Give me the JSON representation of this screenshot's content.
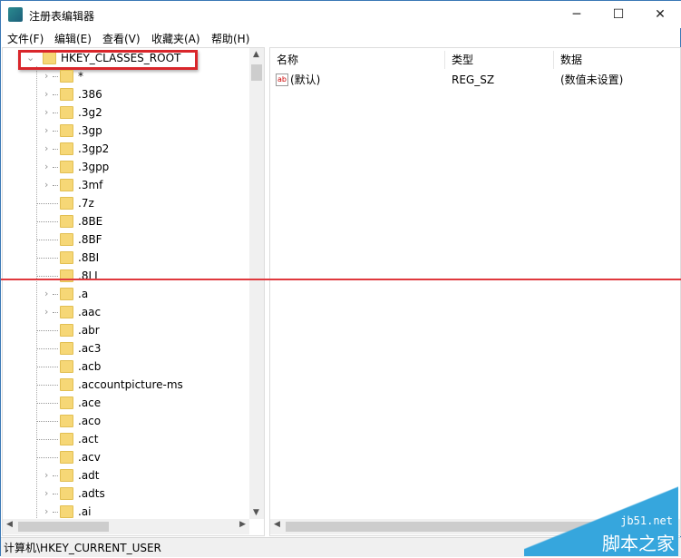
{
  "window": {
    "title": "注册表编辑器",
    "minimize": "─",
    "maximize": "☐",
    "close": "✕"
  },
  "menu": [
    "文件(F)",
    "编辑(E)",
    "查看(V)",
    "收藏夹(A)",
    "帮助(H)"
  ],
  "tree": {
    "root": "HKEY_CLASSES_ROOT",
    "items": [
      {
        "label": "*",
        "expandable": true
      },
      {
        "label": ".386",
        "expandable": true
      },
      {
        "label": ".3g2",
        "expandable": true
      },
      {
        "label": ".3gp",
        "expandable": true
      },
      {
        "label": ".3gp2",
        "expandable": true
      },
      {
        "label": ".3gpp",
        "expandable": true
      },
      {
        "label": ".3mf",
        "expandable": true
      },
      {
        "label": ".7z",
        "expandable": false
      },
      {
        "label": ".8BE",
        "expandable": false
      },
      {
        "label": ".8BF",
        "expandable": false
      },
      {
        "label": ".8BI",
        "expandable": false
      },
      {
        "label": ".8LI",
        "expandable": false
      },
      {
        "label": ".a",
        "expandable": true
      },
      {
        "label": ".aac",
        "expandable": true
      },
      {
        "label": ".abr",
        "expandable": false
      },
      {
        "label": ".ac3",
        "expandable": false
      },
      {
        "label": ".acb",
        "expandable": false
      },
      {
        "label": ".accountpicture-ms",
        "expandable": false
      },
      {
        "label": ".ace",
        "expandable": false
      },
      {
        "label": ".aco",
        "expandable": false
      },
      {
        "label": ".act",
        "expandable": false
      },
      {
        "label": ".acv",
        "expandable": false
      },
      {
        "label": ".adt",
        "expandable": true
      },
      {
        "label": ".adts",
        "expandable": true
      },
      {
        "label": ".ai",
        "expandable": true
      }
    ]
  },
  "values": {
    "columns": [
      "名称",
      "类型",
      "数据"
    ],
    "rows": [
      {
        "name": "(默认)",
        "type": "REG_SZ",
        "data": "(数值未设置)",
        "icon": "ab"
      }
    ]
  },
  "status": "计算机\\HKEY_CURRENT_USER",
  "watermark": {
    "url": "jb51.net",
    "name": "脚本之家"
  }
}
